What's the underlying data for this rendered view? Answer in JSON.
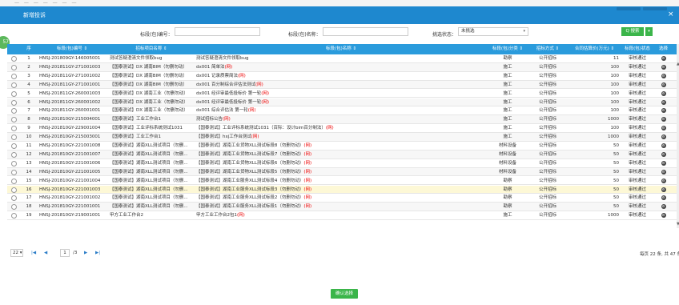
{
  "background": {
    "text": "一 一 一 一 一 一 一"
  },
  "dialog": {
    "title": "新增投诉",
    "close_glyph": "×"
  },
  "side_badge": "57",
  "filters": {
    "section_no_label": "标段(包)编号：",
    "section_no_value": "",
    "section_name_label": "标段(包)名称：",
    "section_name_value": "",
    "pick_status_label": "挑选状态：",
    "pick_status_value": "未挑选",
    "search_label": "Q 搜索",
    "dropdown_glyph": "▾"
  },
  "table": {
    "headers": {
      "index": "序",
      "section_no": "标段(包)编号 ⇕",
      "project_name": "招标项目名称 ⇕",
      "section_name": "标段(包)名称 ⇕",
      "category": "标段(包)分类 ⇕",
      "method": "招标方式 ⇕",
      "budget": "合同估算价(万元) ⇕",
      "status": "标段(包)状态",
      "select": "选择"
    },
    "rows": [
      {
        "idx": "1",
        "no": "HNSJ-201809GY-146005001",
        "project": "测试答疑澄清文件领取bug",
        "name": "测试答疑澄清文件领取bug",
        "mark": "",
        "cat": "勘察",
        "method": "公开招标",
        "budget": "11",
        "status": "审核通过"
      },
      {
        "idx": "2",
        "no": "HNSJ-201811GY-271001003",
        "project": "【国泰测试】DX 湖南BIM（勿删勿动）",
        "name": "dx001 简单法",
        "mark": "(网)",
        "cat": "施工",
        "method": "公开招标",
        "budget": "100",
        "status": "审核通过"
      },
      {
        "idx": "3",
        "no": "HNSJ-201811GY-271001002",
        "project": "【国泰测试】DX 湖南BIM（勿删勿动）",
        "name": "dx001 记录质票简法",
        "mark": "(网)",
        "cat": "施工",
        "method": "公开招标",
        "budget": "100",
        "status": "审核通过"
      },
      {
        "idx": "4",
        "no": "HNSJ-201811GY-271001001",
        "project": "【国泰测试】DX 湖南BIM（勿删勿动）",
        "name": "dx001 百分制综合评估法测试",
        "mark": "(网)",
        "cat": "施工",
        "method": "公开招标",
        "budget": "100",
        "status": "审核通过"
      },
      {
        "idx": "5",
        "no": "HNSJ-201811GY-260001003",
        "project": "【国泰测试】DX 湖南工业（勿删勿动）",
        "name": "dx001 经评审最低投标价 第一轮",
        "mark": "(网)",
        "cat": "施工",
        "method": "公开招标",
        "budget": "100",
        "status": "审核通过"
      },
      {
        "idx": "6",
        "no": "HNSJ-201811GY-260001002",
        "project": "【国泰测试】DX 湖南工业（勿删勿动）",
        "name": "dx001 经评审最低投标价 第一轮",
        "mark": "(网)",
        "cat": "施工",
        "method": "公开招标",
        "budget": "100",
        "status": "审核通过"
      },
      {
        "idx": "7",
        "no": "HNSJ-201811GY-260001001",
        "project": "【国泰测试】DX 湖南工业（勿删勿动）",
        "name": "dx001 综合评估法 第一轮",
        "mark": "(网)",
        "cat": "施工",
        "method": "公开招标",
        "budget": "100",
        "status": "审核通过"
      },
      {
        "idx": "8",
        "no": "HNSJ-201810GY-215004001",
        "project": "【国泰测试】工业工作台1",
        "name": "测试招标公告",
        "mark": "(网)",
        "cat": "施工",
        "method": "公开招标",
        "budget": "1000",
        "status": "审核通过"
      },
      {
        "idx": "9",
        "no": "HNSJ-201810GY-229001004",
        "project": "【国泰测试】工业评标系统测试1031",
        "name": "【国泰测试】工业评标系统测试1031（百际：设计bim百分制法）",
        "mark": "(网)",
        "cat": "施工",
        "method": "公开招标",
        "budget": "100",
        "status": "审核通过"
      },
      {
        "idx": "10",
        "no": "HNSJ-201810GY-215003001",
        "project": "【国泰测试】工业工作台1",
        "name": "【国泰测试】hxj工作台测试",
        "mark": "(网)",
        "cat": "施工",
        "method": "公开招标",
        "budget": "1000",
        "status": "审核通过"
      },
      {
        "idx": "11",
        "no": "HNSJ-201810GY-221001008",
        "project": "【国泰测试】湖南XLL测试项目（勿删...",
        "name": "【国泰测试】湖南工业货物XLL测试标段8（勿删勿动）",
        "mark": "(网)",
        "cat": "材料设备",
        "method": "公开招标",
        "budget": "50",
        "status": "审核通过"
      },
      {
        "idx": "12",
        "no": "HNSJ-201810GY-221001007",
        "project": "【国泰测试】湖南XLL测试项目（勿删...",
        "name": "【国泰测试】湖南工业货物XLL测试标段7（勿删勿动）",
        "mark": "(网)",
        "cat": "材料设备",
        "method": "公开招标",
        "budget": "50",
        "status": "审核通过"
      },
      {
        "idx": "13",
        "no": "HNSJ-201810GY-221001006",
        "project": "【国泰测试】湖南XLL测试项目（勿删...",
        "name": "【国泰测试】湖南工业货物XLL测试标段6（勿删勿动）",
        "mark": "(网)",
        "cat": "材料设备",
        "method": "公开招标",
        "budget": "50",
        "status": "审核通过"
      },
      {
        "idx": "14",
        "no": "HNSJ-201810GY-221001005",
        "project": "【国泰测试】湖南XLL测试项目（勿删...",
        "name": "【国泰测试】湖南工业货物XLL测试标段5（勿删勿动）",
        "mark": "(网)",
        "cat": "材料设备",
        "method": "公开招标",
        "budget": "50",
        "status": "审核通过"
      },
      {
        "idx": "15",
        "no": "HNSJ-201810GY-221001004",
        "project": "【国泰测试】湖南XLL测试项目（勿删...",
        "name": "【国泰测试】湖南工业服务XLL测试标段4（勿删勿动）",
        "mark": "(网)",
        "cat": "勘察",
        "method": "公开招标",
        "budget": "50",
        "status": "审核通过"
      },
      {
        "idx": "16",
        "no": "HNSJ-201810GY-221001003",
        "project": "【国泰测试】湖南XLL测试项目（勿删...",
        "name": "【国泰测试】湖南工业服务XLL测试标段3（勿删勿动）",
        "mark": "(网)",
        "cat": "勘察",
        "method": "公开招标",
        "budget": "50",
        "status": "审核通过"
      },
      {
        "idx": "17",
        "no": "HNSJ-201810GY-221001002",
        "project": "【国泰测试】湖南XLL测试项目（勿删...",
        "name": "【国泰测试】湖南工业服务XLL测试标段2（勿删勿动）",
        "mark": "(网)",
        "cat": "勘察",
        "method": "公开招标",
        "budget": "50",
        "status": "审核通过"
      },
      {
        "idx": "18",
        "no": "HNSJ-201810GY-221001001",
        "project": "【国泰测试】湖南XLL测试项目（勿删...",
        "name": "【国泰测试】湖南工业服务XLL测试标段1（勿删勿动）",
        "mark": "(网)",
        "cat": "勘察",
        "method": "公开招标",
        "budget": "50",
        "status": "审核通过"
      },
      {
        "idx": "19",
        "no": "HNSJ-201810GY-219001001",
        "project": "甲方工业工作台2",
        "name": "甲方工业工作台2包1",
        "mark": "(网)",
        "cat": "施工",
        "method": "公开招标",
        "budget": "1000",
        "status": "审核通过"
      }
    ],
    "op_glyph": "⚙"
  },
  "pager": {
    "page_size": "22 ▾",
    "first": "|◀",
    "prev": "◀",
    "page": "1",
    "of_pages": "/3",
    "next": "▶",
    "last": "▶|",
    "info": "每页 22 条, 共 47 条"
  },
  "confirm_label": "确认选择",
  "colors": {
    "primary": "#1e88cf",
    "header": "#2a9bdc",
    "green": "#3bb54a",
    "highlight_row": "#fdf8d6",
    "net_mark": "#e00000"
  }
}
